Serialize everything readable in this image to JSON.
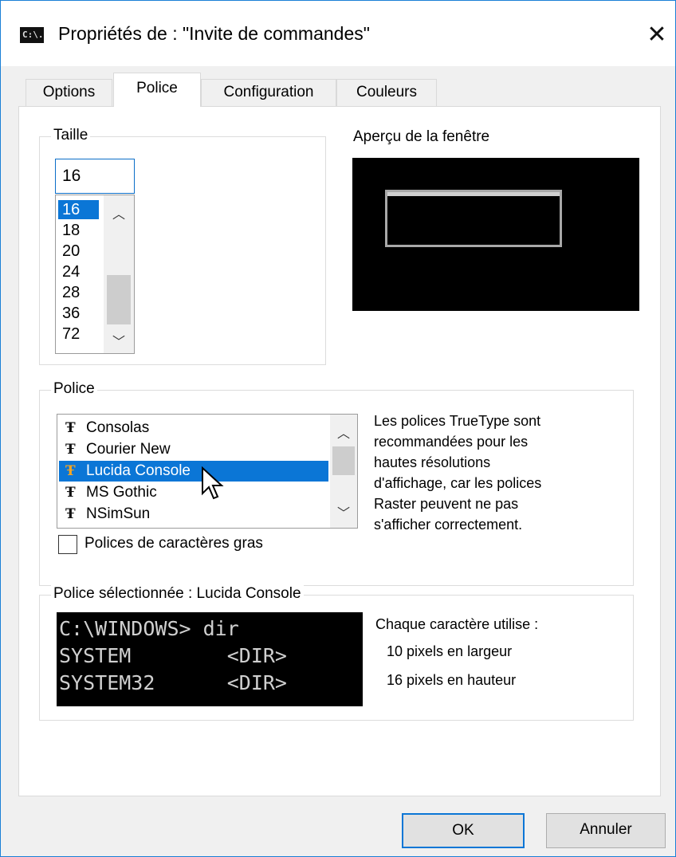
{
  "window": {
    "title": "Propriétés de : \"Invite de commandes\"",
    "icon_text": "C:\\.",
    "close_symbol": "✕"
  },
  "tabs": [
    {
      "label": "Options",
      "active": false
    },
    {
      "label": "Police",
      "active": true
    },
    {
      "label": "Configuration",
      "active": false
    },
    {
      "label": "Couleurs",
      "active": false
    }
  ],
  "size_group": {
    "label": "Taille",
    "input_value": "16",
    "items": [
      "16",
      "18",
      "20",
      "24",
      "28",
      "36",
      "72"
    ],
    "selected": "16"
  },
  "preview": {
    "label": "Aperçu de la fenêtre"
  },
  "font_group": {
    "label": "Police",
    "items": [
      "Consolas",
      "Courier New",
      "Lucida Console",
      "MS Gothic",
      "NSimSun"
    ],
    "selected": "Lucida Console",
    "description": "Les polices TrueType sont recommandées pour les hautes résolutions d'affichage, car les polices Raster peuvent ne pas s'afficher correctement.",
    "description_lines": [
      "Les polices TrueType sont",
      "recommandées pour les",
      "hautes résolutions",
      "d'affichage, car les polices",
      "Raster peuvent ne pas",
      "s'afficher correctement."
    ],
    "bold_checkbox_label": "Polices de caractères gras",
    "bold_checked": false
  },
  "selected_font_group": {
    "label": "Police sélectionnée : Lucida Console",
    "sample_lines": [
      "C:\\WINDOWS> dir",
      "SYSTEM        <DIR>",
      "SYSTEM32      <DIR>"
    ],
    "char_info_title": "Chaque caractère utilise :",
    "width_text": "10 pixels en largeur",
    "height_text": "16 pixels en hauteur"
  },
  "buttons": {
    "ok": "OK",
    "cancel": "Annuler"
  },
  "colors": {
    "accent": "#0b76d6",
    "selection_text": "#ffffff",
    "window_border": "#1a7fd6"
  },
  "icons": {
    "truetype": "T-font-icon",
    "scroll_up": "chevron-up-icon",
    "scroll_down": "chevron-down-icon"
  }
}
